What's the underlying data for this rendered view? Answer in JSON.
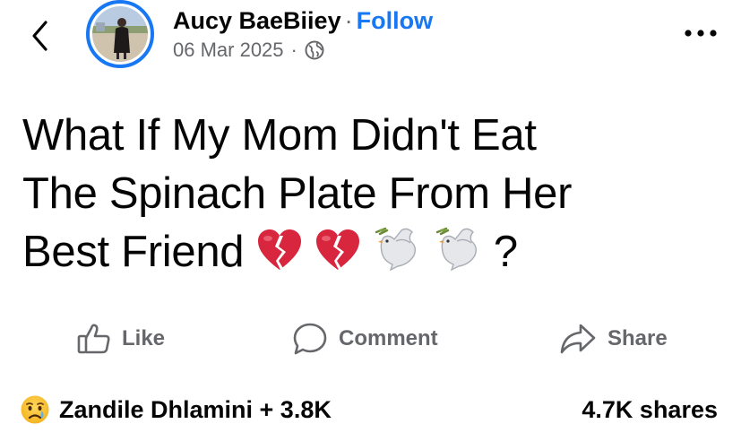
{
  "post": {
    "author_name": "Aucy BaeBiiey",
    "separator": "·",
    "follow_label": "Follow",
    "date": "06 Mar 2025",
    "privacy_icon": "globe-icon",
    "text_lines": [
      "What If My Mom Didn't  Eat",
      "The Spinach  Plate From Her",
      "Best Friend"
    ],
    "text_end": "?",
    "inline_emojis": [
      "broken-heart-emoji",
      "broken-heart-emoji",
      "dove-emoji",
      "dove-emoji"
    ]
  },
  "nav": {
    "back_icon": "chevron-left-icon",
    "more_icon": "more-horizontal-icon"
  },
  "actions": {
    "like_label": "Like",
    "comment_label": "Comment",
    "share_label": "Share"
  },
  "stats": {
    "reaction_icon": "sad-face-emoji",
    "reactions_text": "Zandile Dhlamini + 3.8K",
    "shares_text": "4.7K shares"
  },
  "colors": {
    "accent": "#1877f2",
    "secondary_text": "#65676b",
    "primary_text": "#050505",
    "heart": "#d7263d"
  }
}
